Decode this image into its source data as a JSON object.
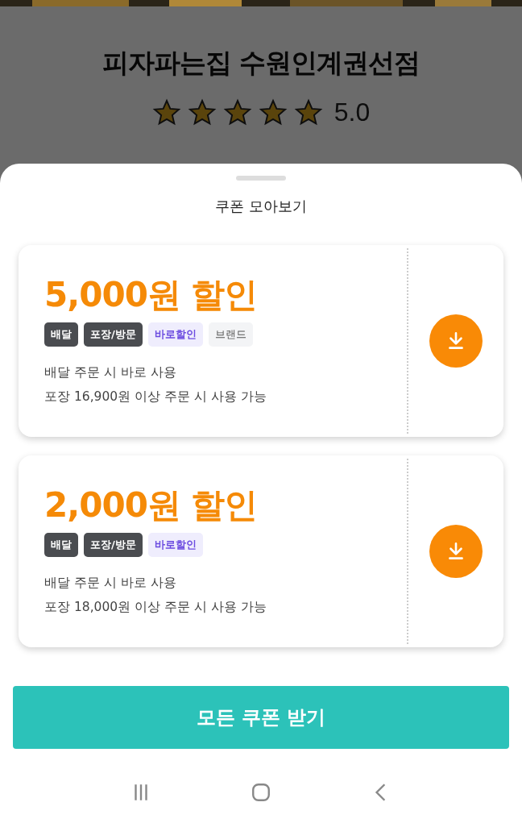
{
  "store": {
    "name": "피자파는집 수원인계권선점",
    "stars": 5,
    "rating": "5.0"
  },
  "sheet": {
    "title": "쿠폰 모아보기",
    "coupons": [
      {
        "amount": "5,000원 할인",
        "tags": [
          {
            "label": "배달",
            "kind": "dark"
          },
          {
            "label": "포장/방문",
            "kind": "dark"
          },
          {
            "label": "바로할인",
            "kind": "purple"
          },
          {
            "label": "브랜드",
            "kind": "light"
          }
        ],
        "lines": [
          "배달 주문 시 바로 사용",
          "포장 16,900원 이상 주문 시 사용 가능"
        ]
      },
      {
        "amount": "2,000원 할인",
        "tags": [
          {
            "label": "배달",
            "kind": "dark"
          },
          {
            "label": "포장/방문",
            "kind": "dark"
          },
          {
            "label": "바로할인",
            "kind": "purple"
          }
        ],
        "lines": [
          "배달 주문 시 바로 사용",
          "포장 18,000원 이상 주문 시 사용 가능"
        ]
      }
    ],
    "button": "모든 쿠폰 받기"
  }
}
